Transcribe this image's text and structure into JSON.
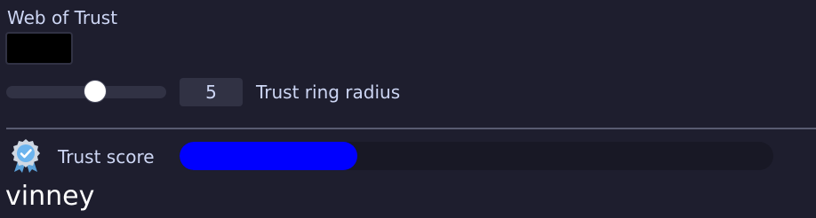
{
  "panel": {
    "title": "Web of Trust",
    "color": "#000000"
  },
  "trust_ring": {
    "value": "5",
    "label": "Trust ring radius",
    "slider_fraction": 0.45
  },
  "trust_score": {
    "label": "Trust score",
    "fraction": 0.3,
    "fill_color": "#0000ff",
    "icon": "award-badge-icon"
  },
  "user": {
    "name": "vinney"
  }
}
